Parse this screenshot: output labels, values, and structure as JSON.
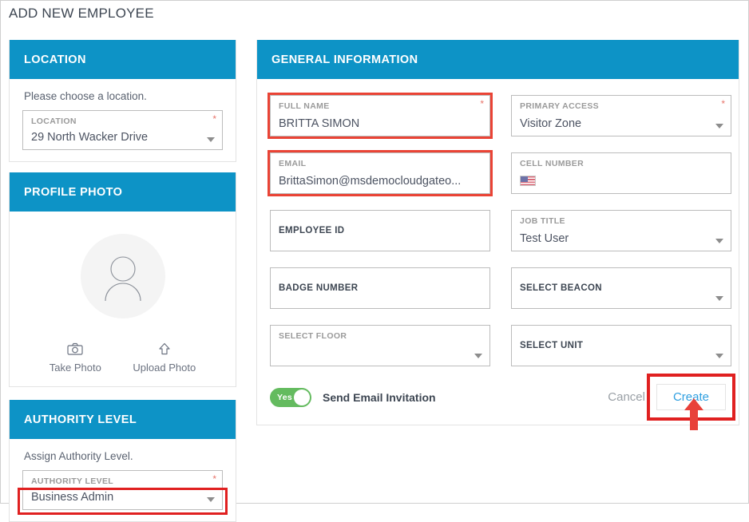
{
  "page": {
    "title": "ADD NEW EMPLOYEE"
  },
  "colors": {
    "header_blue": "#0d93c6",
    "annotation_red": "#ea4335",
    "create_blue": "#2f9fe0",
    "toggle_green": "#64bb5f",
    "required_star": "#e8756b"
  },
  "location_panel": {
    "header": "LOCATION",
    "helper": "Please choose a location.",
    "field": {
      "label": "LOCATION",
      "value": "29 North Wacker Drive",
      "required": true,
      "required_mark": "*",
      "has_caret": true
    }
  },
  "profile_panel": {
    "header": "PROFILE PHOTO",
    "avatar_icon": "person-placeholder-icon",
    "actions": [
      {
        "label": "Take Photo",
        "icon": "camera-icon"
      },
      {
        "label": "Upload Photo",
        "icon": "upload-arrow-icon"
      }
    ]
  },
  "authority_panel": {
    "header": "AUTHORITY LEVEL",
    "helper": "Assign Authority Level.",
    "field": {
      "label": "AUTHORITY LEVEL",
      "value": "Business Admin",
      "required": true,
      "required_mark": "*",
      "has_caret": true,
      "highlighted": true
    }
  },
  "general_panel": {
    "header": "GENERAL INFORMATION",
    "fields": [
      {
        "name": "full-name",
        "label": "FULL NAME",
        "value": "BRITTA SIMON",
        "required": true,
        "required_mark": "*",
        "caret": false,
        "highlighted": true,
        "label_style": "top"
      },
      {
        "name": "primary-access",
        "label": "PRIMARY ACCESS",
        "value": "Visitor Zone",
        "required": true,
        "required_mark": "*",
        "caret": true,
        "highlighted": false,
        "label_style": "top"
      },
      {
        "name": "email",
        "label": "EMAIL",
        "value": "BrittaSimon@msdemocloudgateo...",
        "required": false,
        "required_mark": "",
        "caret": false,
        "highlighted": true,
        "label_style": "top"
      },
      {
        "name": "cell-number",
        "label": "CELL NUMBER",
        "value": "",
        "required": false,
        "required_mark": "",
        "caret": false,
        "highlighted": false,
        "label_style": "top",
        "icon": "us-flag-icon"
      },
      {
        "name": "employee-id",
        "label": "EMPLOYEE ID",
        "value": "",
        "required": false,
        "required_mark": "",
        "caret": false,
        "highlighted": false,
        "label_style": "centered"
      },
      {
        "name": "job-title",
        "label": "JOB TITLE",
        "value": "Test User",
        "required": false,
        "required_mark": "",
        "caret": true,
        "highlighted": false,
        "label_style": "top"
      },
      {
        "name": "badge-number",
        "label": "BADGE NUMBER",
        "value": "",
        "required": false,
        "required_mark": "",
        "caret": false,
        "highlighted": false,
        "label_style": "centered"
      },
      {
        "name": "select-beacon",
        "label": "SELECT BEACON",
        "value": "",
        "required": false,
        "required_mark": "",
        "caret": true,
        "highlighted": false,
        "label_style": "centered"
      },
      {
        "name": "select-floor",
        "label": "SELECT FLOOR",
        "value": "",
        "required": false,
        "required_mark": "",
        "caret": true,
        "highlighted": false,
        "label_style": "top"
      },
      {
        "name": "select-unit",
        "label": "SELECT UNIT",
        "value": "",
        "required": false,
        "required_mark": "",
        "caret": true,
        "highlighted": false,
        "label_style": "centered"
      }
    ],
    "toggle": {
      "state_text": "Yes",
      "label": "Send Email Invitation",
      "on": true
    },
    "cancel_label": "Cancel",
    "create_label": "Create"
  },
  "annotations": {
    "arrow": "red-up-arrow-pointing-to-create"
  }
}
